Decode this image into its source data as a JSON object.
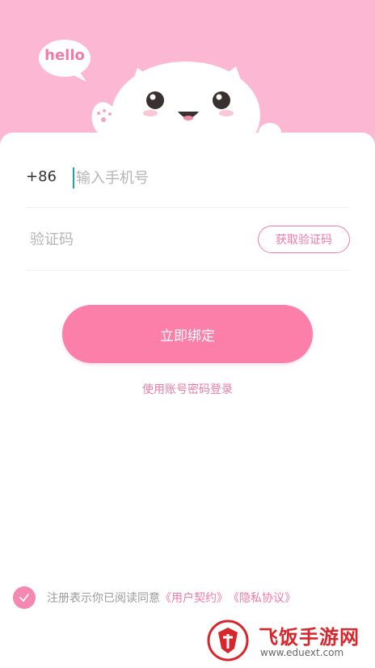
{
  "header": {
    "bubble_text": "hello",
    "background_color": "#fcb8d2",
    "mascot": "cat-icon"
  },
  "form": {
    "country_code": "+86",
    "phone_placeholder": "输入手机号",
    "code_placeholder": "验证码",
    "get_code_label": "获取验证码"
  },
  "actions": {
    "bind_label": "立即绑定",
    "password_login_label": "使用账号密码登录"
  },
  "agreement": {
    "checked": true,
    "prefix": "注册表示你已阅读同意",
    "user_agreement": "《用户契约》",
    "privacy_policy": "《隐私协议》"
  },
  "watermark": {
    "title": "飞饭手游网",
    "domain": "www.eduext.com"
  },
  "colors": {
    "accent": "#fb7fa8",
    "accent_text": "#f07aa6",
    "header_pink": "#fcb8d2"
  }
}
